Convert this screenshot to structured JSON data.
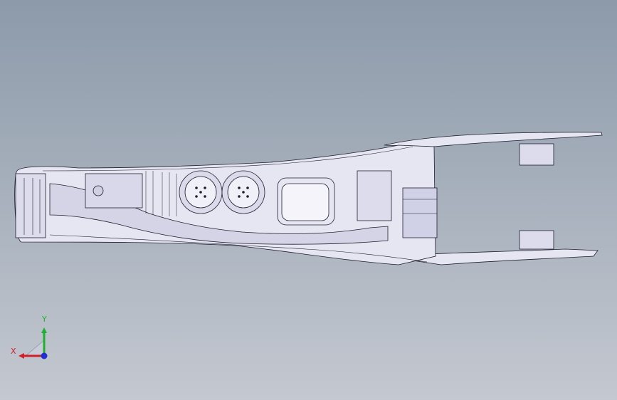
{
  "viewport": {
    "background_top": "#8c9aaa",
    "background_bottom": "#c4c8d0",
    "model_fill": "#e6e6f2",
    "model_edge": "#1e1e2e",
    "model_shadow": "#b8b8d0"
  },
  "triad": {
    "x_label": "X",
    "y_label": "Y",
    "x_color": "#d0202a",
    "y_color": "#20b030",
    "z_color": "#2030d0"
  }
}
